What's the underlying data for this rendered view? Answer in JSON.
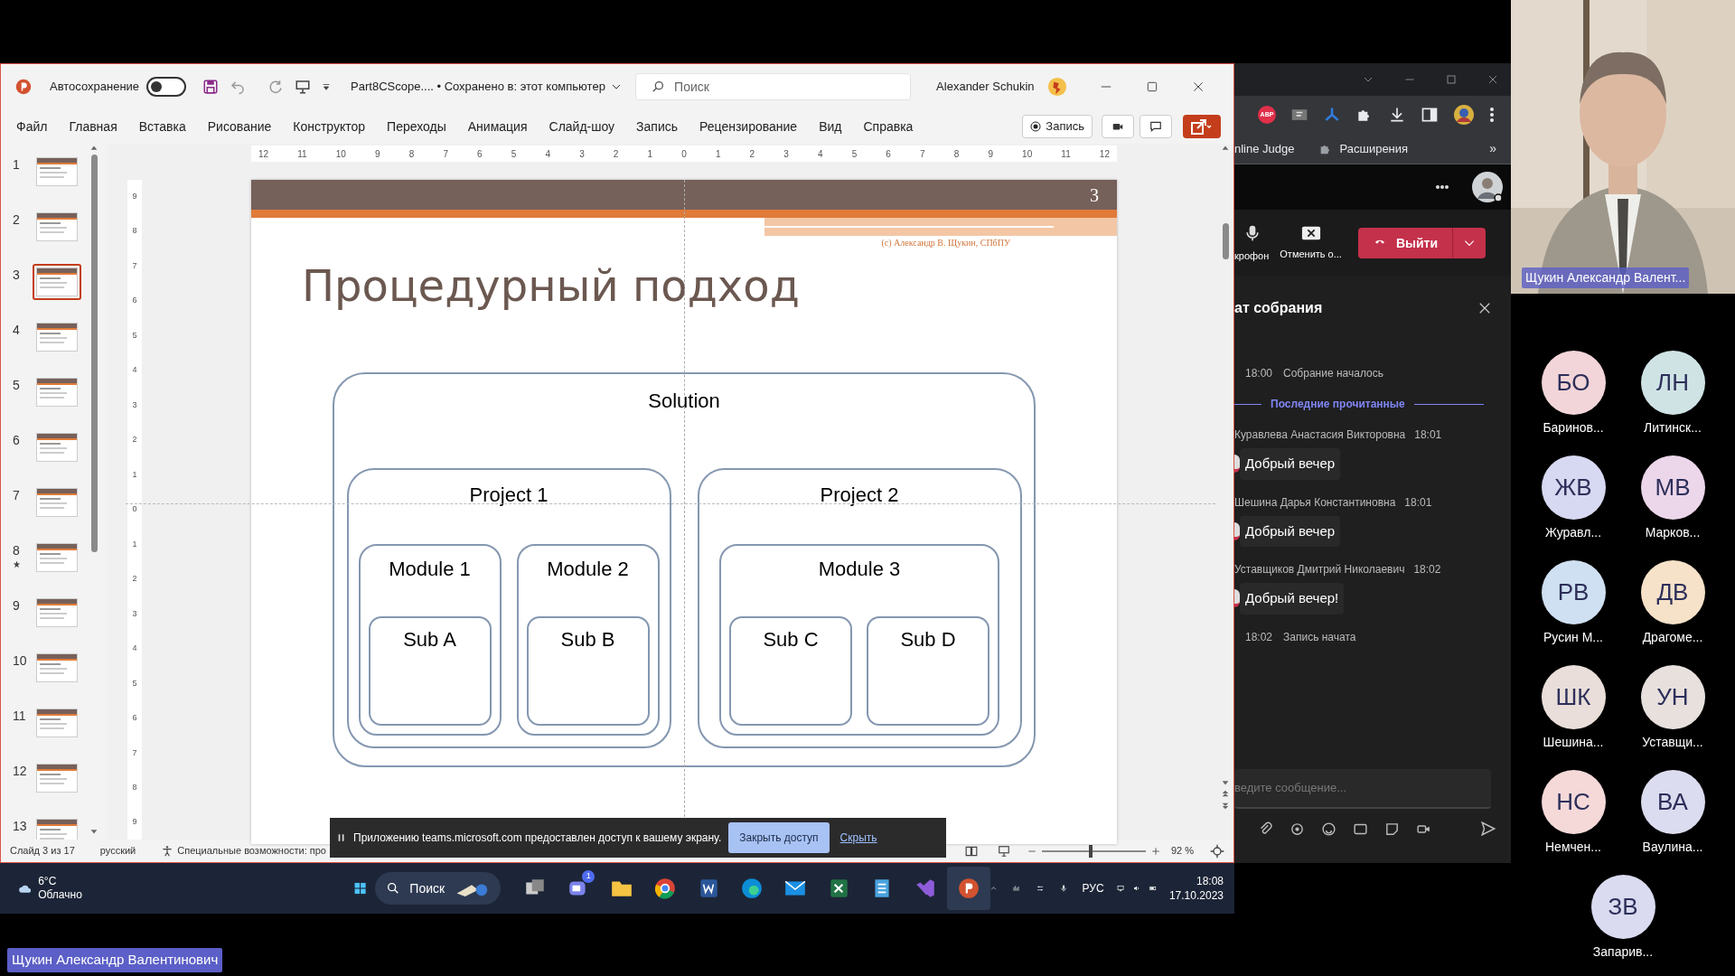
{
  "powerpoint": {
    "title_bar": {
      "autosave_label": "Автосохранение",
      "autosave_on": false,
      "file_title": "Part8CScope.... • Сохранено в: этот компьютер",
      "search_placeholder": "Поиск",
      "user": "Alexander Schukin"
    },
    "menu": [
      "Файл",
      "Главная",
      "Вставка",
      "Рисование",
      "Конструктор",
      "Переходы",
      "Анимация",
      "Слайд-шоу",
      "Запись",
      "Рецензирование",
      "Вид",
      "Справка"
    ],
    "record_button": "Запись",
    "ruler_h": [
      "12",
      "11",
      "10",
      "9",
      "8",
      "7",
      "6",
      "5",
      "4",
      "3",
      "2",
      "1",
      "0",
      "1",
      "2",
      "3",
      "4",
      "5",
      "6",
      "7",
      "8",
      "9",
      "10",
      "11",
      "12"
    ],
    "ruler_v": [
      "9",
      "8",
      "7",
      "6",
      "5",
      "4",
      "3",
      "2",
      "1",
      "0",
      "1",
      "2",
      "3",
      "4",
      "5",
      "6",
      "7",
      "8",
      "9"
    ],
    "thumbnails": [
      {
        "number": "1",
        "selected": false,
        "starred": false
      },
      {
        "number": "2",
        "selected": false,
        "starred": false
      },
      {
        "number": "3",
        "selected": true,
        "starred": false
      },
      {
        "number": "4",
        "selected": false,
        "starred": false
      },
      {
        "number": "5",
        "selected": false,
        "starred": false
      },
      {
        "number": "6",
        "selected": false,
        "starred": false
      },
      {
        "number": "7",
        "selected": false,
        "starred": false
      },
      {
        "number": "8",
        "selected": false,
        "starred": true
      },
      {
        "number": "9",
        "selected": false,
        "starred": false
      },
      {
        "number": "10",
        "selected": false,
        "starred": false
      },
      {
        "number": "11",
        "selected": false,
        "starred": false
      },
      {
        "number": "12",
        "selected": false,
        "starred": false
      },
      {
        "number": "13",
        "selected": false,
        "starred": false
      }
    ],
    "slide": {
      "number": "3",
      "credit": "(c) Александр В. Щукин, СПбПУ",
      "title": "Процедурный подход",
      "diagram": {
        "label": "Solution",
        "children": [
          {
            "label": "Project 1",
            "children": [
              {
                "label": "Module 1",
                "children": [
                  {
                    "label": "Sub A"
                  }
                ]
              },
              {
                "label": "Module 2",
                "children": [
                  {
                    "label": "Sub B"
                  }
                ]
              }
            ]
          },
          {
            "label": "Project 2",
            "children": [
              {
                "label": "Module 3",
                "children": [
                  {
                    "label": "Sub C"
                  },
                  {
                    "label": "Sub D"
                  }
                ]
              }
            ]
          }
        ]
      }
    },
    "status_bar": {
      "slide": "Слайд 3 из 17",
      "language": "русский",
      "accessibility": "Специальные возможности: про",
      "zoom": "92 %",
      "level": 0.45
    }
  },
  "share_banner": {
    "message": "Приложению teams.microsoft.com предоставлен доступ к вашему экрану.",
    "stop_button": "Закрыть доступ",
    "hide_link": "Скрыть"
  },
  "taskbar": {
    "temperature": "6°C",
    "weather": "Облачно",
    "search_placeholder": "Поиск",
    "teams_badge": "1",
    "language": "РУС",
    "time": "18:08",
    "date": "17.10.2023"
  },
  "browser": {
    "extension_label": "ABP",
    "bookmarks": [
      "nline Judge",
      "Расширения"
    ],
    "bookmarks_overflow": "»"
  },
  "teams": {
    "mic_label": "крофон",
    "cancel_label": "Отменить о...",
    "leave_button": "Выйти",
    "chat_title": "ат собрания",
    "chat": [
      {
        "kind": "event",
        "time": "18:00",
        "text": "Собрание началось"
      },
      {
        "kind": "divider",
        "text": "Последние прочитанные"
      },
      {
        "kind": "message",
        "author": "Куравлева Анастасия Викторовна",
        "time": "18:01",
        "text": "Добрый вечер"
      },
      {
        "kind": "message",
        "author": "Шешина Дарья Константиновна",
        "time": "18:01",
        "text": "Добрый вечер"
      },
      {
        "kind": "message",
        "author": "Уставщиков Дмитрий Николаевич",
        "time": "18:02",
        "text": "Добрый вечер!"
      },
      {
        "kind": "event",
        "time": "18:02",
        "text": "Запись начата"
      }
    ],
    "message_placeholder": "ведите сообщение..."
  },
  "video": {
    "name": "Щукин Александр Валент..."
  },
  "participants": [
    {
      "initials": "БО",
      "name": "Баринов...",
      "color": "#f2d5d8"
    },
    {
      "initials": "ЛН",
      "name": "Литинск...",
      "color": "#cfe3e5"
    },
    {
      "initials": "ЖВ",
      "name": "Журавл...",
      "color": "#d7d8f1"
    },
    {
      "initials": "МВ",
      "name": "Марков...",
      "color": "#ecd6ea"
    },
    {
      "initials": "РВ",
      "name": "Русин М...",
      "color": "#cfe0f2"
    },
    {
      "initials": "ДВ",
      "name": "Драгоме...",
      "color": "#f6e2c9"
    },
    {
      "initials": "ШК",
      "name": "Шешина...",
      "color": "#e9ded9"
    },
    {
      "initials": "УН",
      "name": "Уставщи...",
      "color": "#e7e0dc"
    },
    {
      "initials": "НС",
      "name": "Немчен...",
      "color": "#f5d9d9"
    },
    {
      "initials": "ВА",
      "name": "Ваулина...",
      "color": "#dcdcf0"
    },
    {
      "initials": "ЗВ",
      "name": "Запарив...",
      "color": "#dadbf0"
    }
  ],
  "presenter_label": "Щукин Александр Валентинович"
}
